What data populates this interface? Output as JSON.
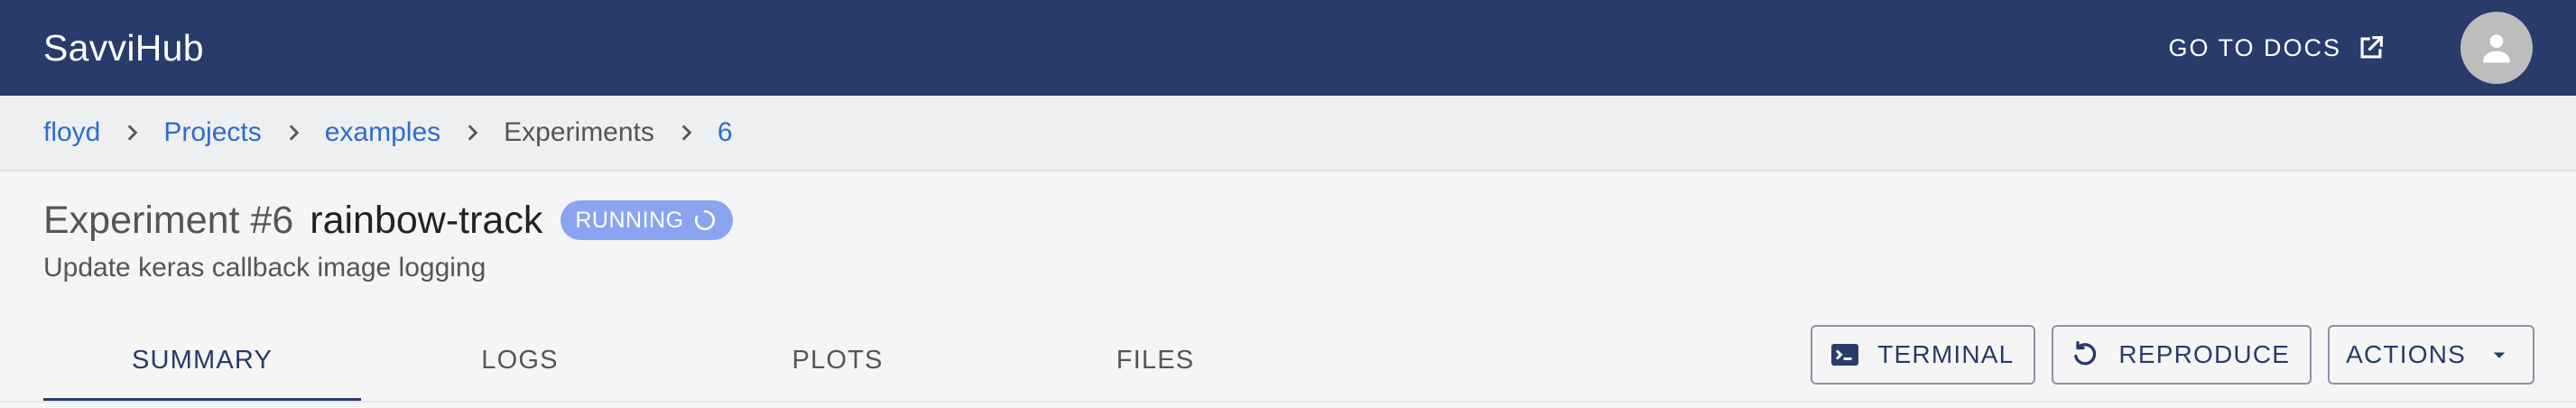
{
  "app": {
    "brand": "SavviHub",
    "docs_label": "GO TO DOCS",
    "docs_icon": "external-link-icon",
    "avatar_icon": "person-icon",
    "header_color": "#283b6a"
  },
  "breadcrumb": {
    "items": [
      {
        "label": "floyd",
        "link": true
      },
      {
        "label": "Projects",
        "link": true
      },
      {
        "label": "examples",
        "link": true
      },
      {
        "label": "Experiments",
        "link": false
      },
      {
        "label": "6",
        "link": true
      }
    ],
    "separator_icon": "chevron-right-icon"
  },
  "experiment": {
    "prefix": "Experiment #6",
    "name": "rainbow-track",
    "status": "RUNNING",
    "status_color": "#8aa4f2",
    "description": "Update keras callback image logging"
  },
  "tabs": [
    {
      "label": "SUMMARY",
      "active": true
    },
    {
      "label": "LOGS",
      "active": false
    },
    {
      "label": "PLOTS",
      "active": false
    },
    {
      "label": "FILES",
      "active": false
    }
  ],
  "actions": {
    "terminal_label": "TERMINAL",
    "reproduce_label": "REPRODUCE",
    "actions_label": "ACTIONS"
  }
}
